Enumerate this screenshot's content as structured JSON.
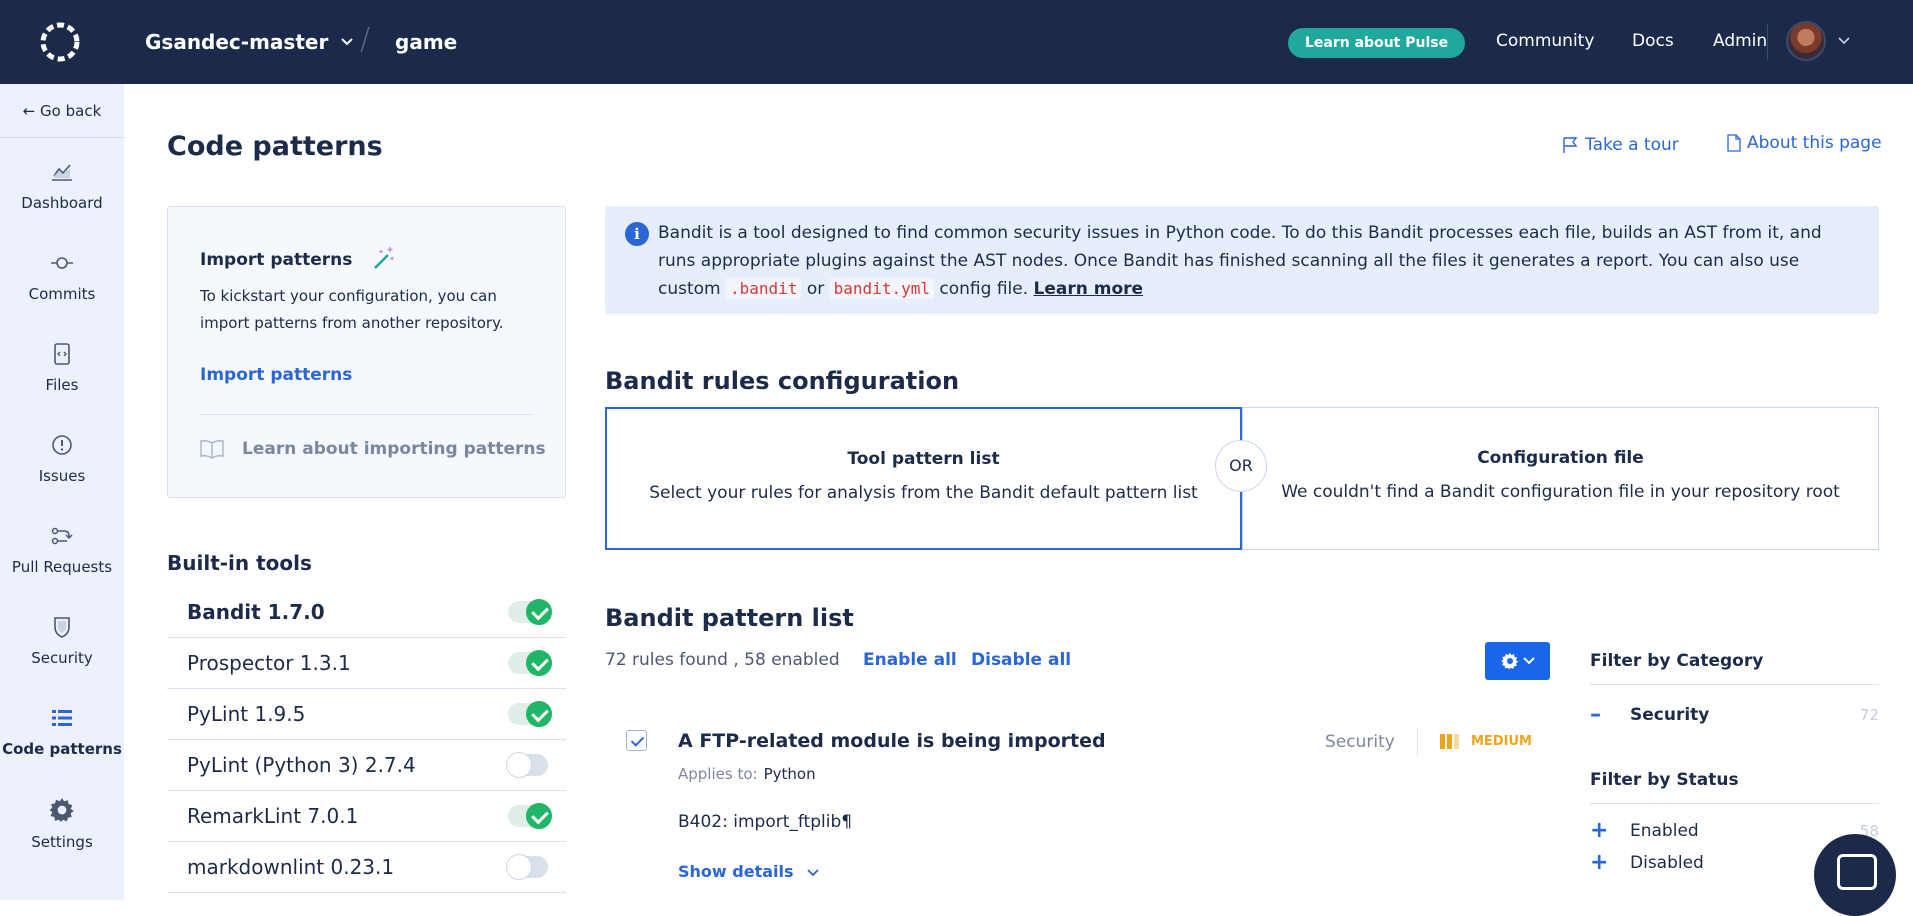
{
  "topbar": {
    "org": "Gsandec-master",
    "project": "game",
    "pulse_button": "Learn about Pulse",
    "nav": [
      "Community",
      "Docs",
      "Admin"
    ]
  },
  "sidebar": {
    "go_back": "← Go back",
    "items": [
      {
        "label": "Dashboard",
        "icon": "chart-icon"
      },
      {
        "label": "Commits",
        "icon": "commit-icon"
      },
      {
        "label": "Files",
        "icon": "file-icon"
      },
      {
        "label": "Issues",
        "icon": "issue-icon"
      },
      {
        "label": "Pull Requests",
        "icon": "pull-request-icon"
      },
      {
        "label": "Security",
        "icon": "shield-icon"
      },
      {
        "label": "Code patterns",
        "icon": "list-icon"
      },
      {
        "label": "Settings",
        "icon": "gear-icon"
      }
    ]
  },
  "page": {
    "title": "Code patterns",
    "take_tour": "Take a tour",
    "about_page": "About this page"
  },
  "import": {
    "title": "Import patterns",
    "text": "To kickstart your configuration, you can import patterns from another repository.",
    "link": "Import patterns",
    "learn": "Learn about importing patterns"
  },
  "builtin": {
    "title": "Built-in tools",
    "tools": [
      {
        "name": "Bandit 1.7.0",
        "enabled": true
      },
      {
        "name": "Prospector 1.3.1",
        "enabled": true
      },
      {
        "name": "PyLint 1.9.5",
        "enabled": true
      },
      {
        "name": "PyLint (Python 3) 2.7.4",
        "enabled": false
      },
      {
        "name": "RemarkLint 7.0.1",
        "enabled": true
      },
      {
        "name": "markdownlint 0.23.1",
        "enabled": false
      }
    ]
  },
  "info": {
    "text1": "Bandit is a tool designed to find common security issues in Python code. To do this Bandit processes each file, builds an AST from it, and runs appropriate plugins against the AST nodes. Once Bandit has finished scanning all the files it generates a report. You can also use custom",
    "code1": ".bandit",
    "or": "or",
    "code2": "bandit.yml",
    "text2": "config file.",
    "learn": "Learn more"
  },
  "config": {
    "title": "Bandit rules configuration",
    "or": "OR",
    "option1_title": "Tool pattern list",
    "option1_desc": "Select your rules for analysis from the Bandit default pattern list",
    "option2_title": "Configuration file",
    "option2_desc": "We couldn't find a Bandit configuration file in your repository root"
  },
  "patterns": {
    "title": "Bandit pattern list",
    "count": "72 rules found , 58 enabled",
    "enable_all": "Enable all",
    "disable_all": "Disable all",
    "item": {
      "title": "A FTP-related module is being imported",
      "category": "Security",
      "level": "MEDIUM",
      "applies_label": "Applies to:",
      "applies_value": "Python",
      "code": "B402: import_ftplib¶",
      "show_details": "Show details"
    }
  },
  "filters": {
    "category_title": "Filter by Category",
    "category_item": "Security",
    "category_count": "72",
    "status_title": "Filter by Status",
    "status_enabled": "Enabled",
    "status_enabled_count": "58",
    "status_disabled": "Disabled"
  },
  "colors": {
    "topbar": "#1b2a4a",
    "accent": "#2a66d4",
    "pulse": "#1fa89b",
    "medium": "#f0a41a",
    "toggle_on": "#20b567"
  }
}
